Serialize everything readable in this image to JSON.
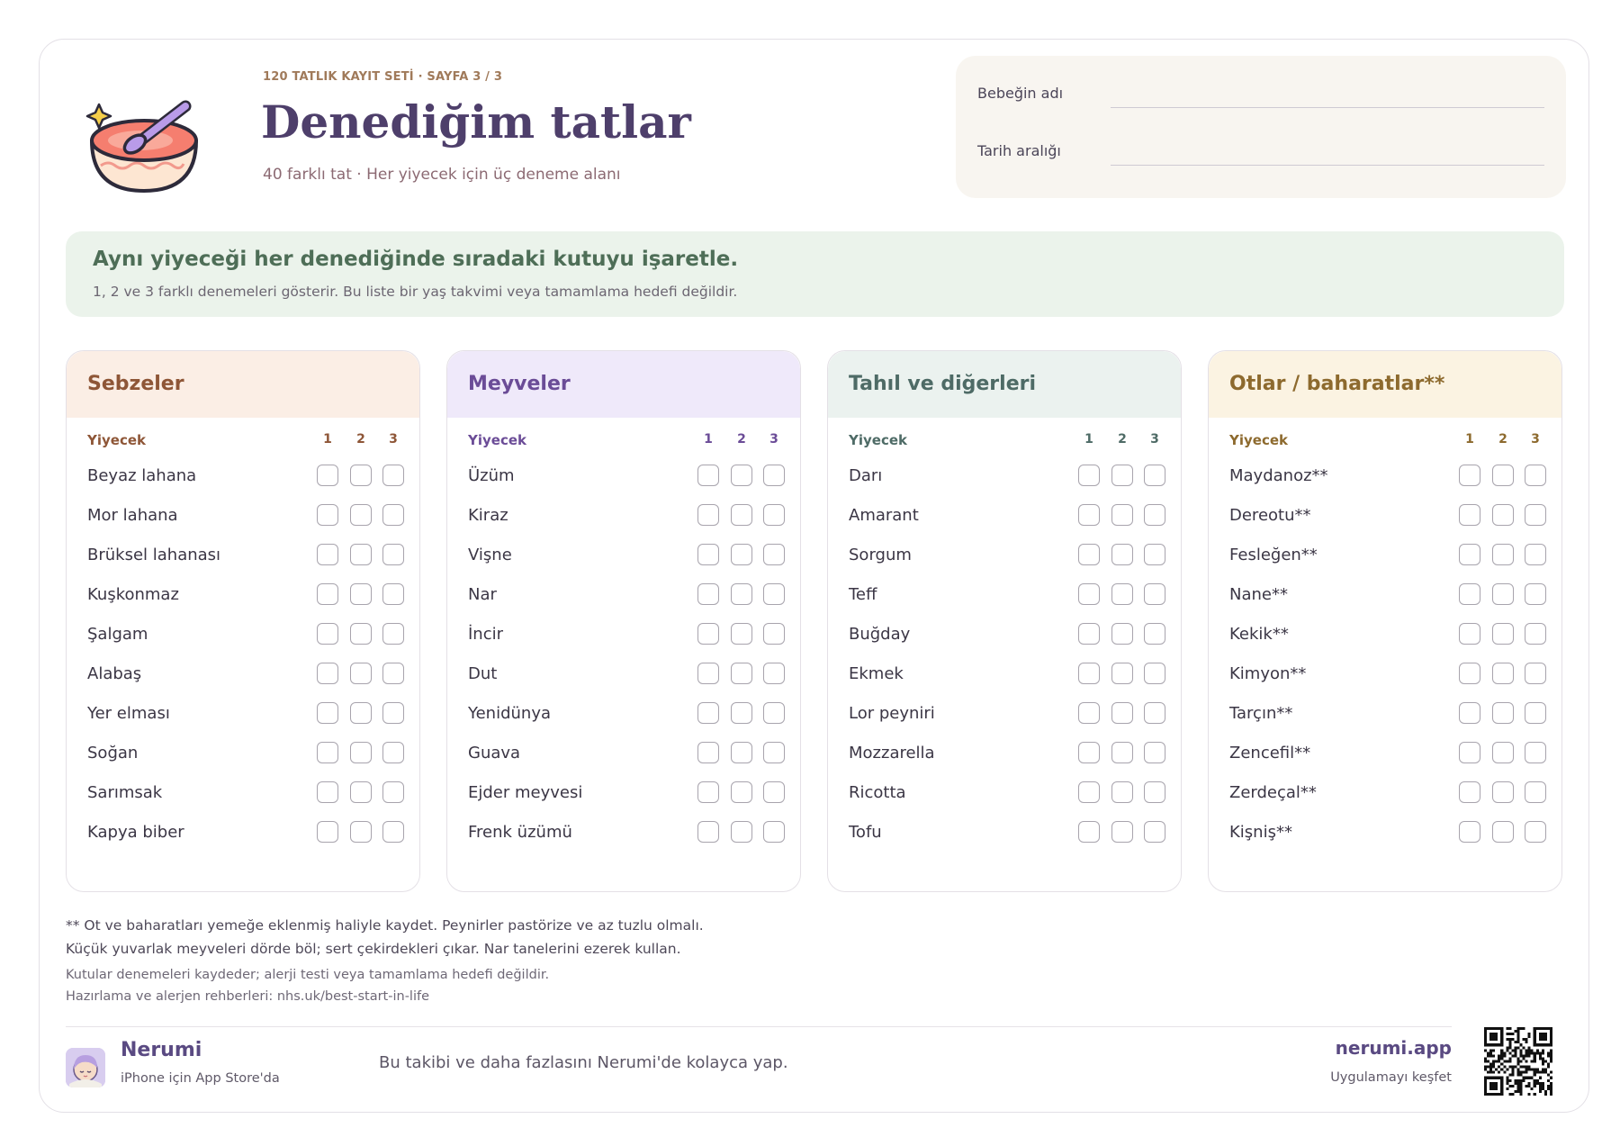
{
  "header": {
    "eyebrow": "120 TATLIK KAYIT SETİ · SAYFA 3 / 3",
    "title": "Denediğim tatlar",
    "subtitle": "40 farklı tat · Her yiyecek için üç deneme alanı",
    "fields": [
      {
        "label": "Bebeğin adı",
        "value": ""
      },
      {
        "label": "Tarih aralığı",
        "value": ""
      }
    ]
  },
  "banner": {
    "heading": "Aynı yiyeceği her denediğinde sıradaki kutuyu işaretle.",
    "text": "1, 2 ve 3 farklı denemeleri gösterir. Bu liste bir yaş takvimi veya tamamlama hedefi değildir."
  },
  "columns": [
    {
      "title": "Sebzeler",
      "header_bg": "#fbeee5",
      "accent": "#8e5637",
      "food_label": "Yiyecek",
      "numbers": [
        "1",
        "2",
        "3"
      ],
      "items": [
        "Beyaz lahana",
        "Mor lahana",
        "Brüksel lahanası",
        "Kuşkonmaz",
        "Şalgam",
        "Alabaş",
        "Yer elması",
        "Soğan",
        "Sarımsak",
        "Kapya biber"
      ]
    },
    {
      "title": "Meyveler",
      "header_bg": "#efe9fa",
      "accent": "#6b4c97",
      "food_label": "Yiyecek",
      "numbers": [
        "1",
        "2",
        "3"
      ],
      "items": [
        "Üzüm",
        "Kiraz",
        "Vişne",
        "Nar",
        "İncir",
        "Dut",
        "Yenidünya",
        "Guava",
        "Ejder meyvesi",
        "Frenk üzümü"
      ]
    },
    {
      "title": "Tahıl ve diğerleri",
      "header_bg": "#ebf2ef",
      "accent": "#4e6b66",
      "food_label": "Yiyecek",
      "numbers": [
        "1",
        "2",
        "3"
      ],
      "items": [
        "Darı",
        "Amarant",
        "Sorgum",
        "Teff",
        "Buğday",
        "Ekmek",
        "Lor peyniri",
        "Mozzarella",
        "Ricotta",
        "Tofu"
      ]
    },
    {
      "title": "Otlar / baharatlar**",
      "header_bg": "#fbf3e2",
      "accent": "#8d6a2e",
      "food_label": "Yiyecek",
      "numbers": [
        "1",
        "2",
        "3"
      ],
      "items": [
        "Maydanoz**",
        "Dereotu**",
        "Fesleğen**",
        "Nane**",
        "Kekik**",
        "Kimyon**",
        "Tarçın**",
        "Zencefil**",
        "Zerdeçal**",
        "Kişniş**"
      ]
    }
  ],
  "notes": [
    "** Ot ve baharatları yemeğe eklenmiş haliyle kaydet. Peynirler pastörize ve az tuzlu olmalı.",
    "Küçük yuvarlak meyveleri dörde böl; sert çekirdekleri çıkar. Nar tanelerini ezerek kullan.",
    "Kutular denemeleri kaydeder; alerji testi veya tamamlama hedefi değildir.",
    "Hazırlama ve alerjen rehberleri: nhs.uk/best-start-in-life"
  ],
  "footer": {
    "brand": "Nerumi",
    "brand_sub": "iPhone için App Store'da",
    "promo": "Bu takibi ve daha fazlasını Nerumi'de kolayca yap.",
    "site": "nerumi.app",
    "site_sub": "Uygulamayı keşfet"
  },
  "icons": {
    "bowl": "baby-food-bowl-icon",
    "logo": "nerumi-baby-logo",
    "qr": "qr-code"
  }
}
